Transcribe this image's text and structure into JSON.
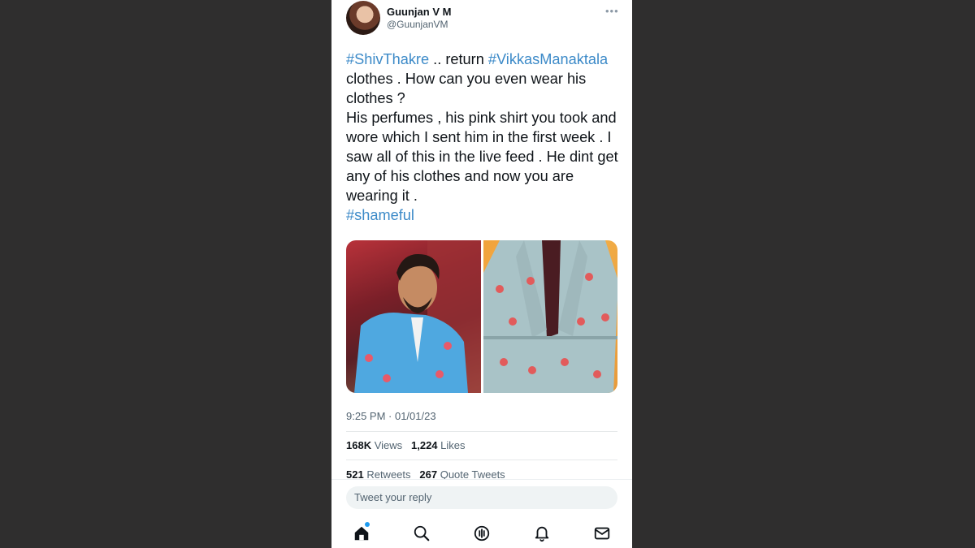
{
  "author": {
    "name": "Guunjan V M",
    "handle": "@GuunjanVM"
  },
  "tweet": {
    "tag1": "#ShivThakre",
    "text1": " .. return ",
    "tag2": "#VikkasManaktala",
    "text2": " clothes . How can you even wear his clothes ?",
    "text3": "His perfumes , his pink shirt you took and wore which I sent him in the first week . I saw all of this in the live feed . He dint get any of his clothes and now you are wearing it .",
    "tag3": "#shameful"
  },
  "timestamp": "9:25 PM · 01/01/23",
  "stats": {
    "views_count": "168K",
    "views_label": "Views",
    "likes_count": "1,224",
    "likes_label": "Likes",
    "retweets_count": "521",
    "retweets_label": "Retweets",
    "quotes_count": "267",
    "quotes_label": "Quote Tweets"
  },
  "reply": {
    "placeholder": "Tweet your reply"
  },
  "nav": {
    "items": [
      "home-icon",
      "search-icon",
      "spaces-icon",
      "notifications-icon",
      "messages-icon"
    ]
  },
  "colors": {
    "hashtag": "#3c8ac8",
    "accent": "#1d9bf0",
    "backdrop": "#2f2e2e"
  }
}
